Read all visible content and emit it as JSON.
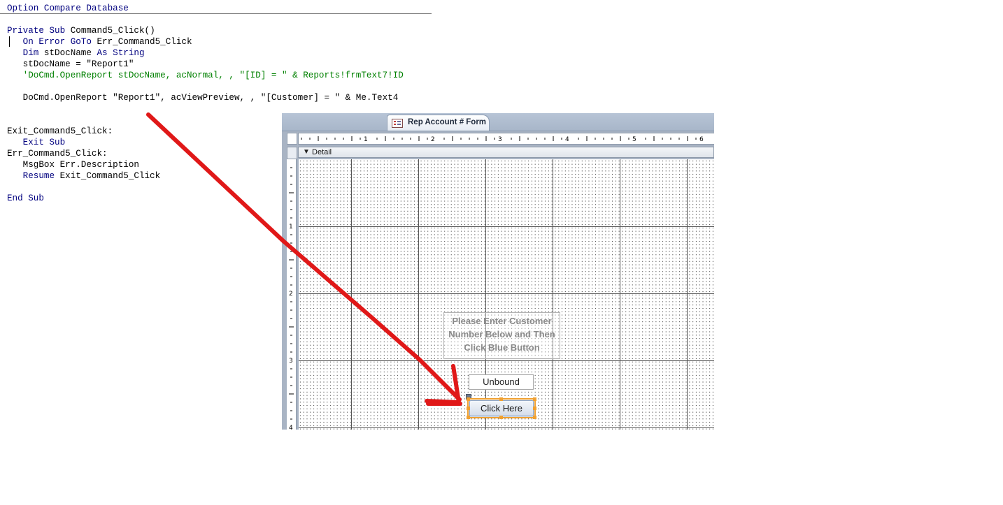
{
  "code_editor": {
    "lines": [
      [
        {
          "t": "Option Compare Database",
          "c": "kw"
        }
      ],
      [],
      [
        {
          "t": "Private Sub ",
          "c": "kw"
        },
        {
          "t": "Command5_Click()",
          "c": "tx"
        }
      ],
      [
        {
          "t": "   On Error GoTo ",
          "c": "kw"
        },
        {
          "t": "Err_Command5_Click",
          "c": "tx"
        }
      ],
      [
        {
          "t": "   Dim ",
          "c": "kw"
        },
        {
          "t": "stDocName ",
          "c": "tx"
        },
        {
          "t": "As String",
          "c": "kw"
        }
      ],
      [
        {
          "t": "   stDocName = \"Report1\"",
          "c": "tx"
        }
      ],
      [
        {
          "t": "   'DoCmd.OpenReport stDocName, acNormal, , \"[ID] = \" & Reports!frmText7!ID",
          "c": "cm"
        }
      ],
      [],
      [
        {
          "t": "   DoCmd.OpenReport \"Report1\", acViewPreview, , \"[Customer] = \" & Me.Text4",
          "c": "tx"
        }
      ],
      [],
      [],
      [
        {
          "t": "Exit_Command5_Click:",
          "c": "tx"
        }
      ],
      [
        {
          "t": "   Exit Sub",
          "c": "kw"
        }
      ],
      [
        {
          "t": "Err_Command5_Click:",
          "c": "tx"
        }
      ],
      [
        {
          "t": "   MsgBox Err.Description",
          "c": "tx"
        }
      ],
      [
        {
          "t": "   Resume ",
          "c": "kw"
        },
        {
          "t": "Exit_Command5_Click",
          "c": "tx"
        }
      ],
      [],
      [
        {
          "t": "End Sub",
          "c": "kw"
        }
      ]
    ]
  },
  "form_designer": {
    "tab_title": "Rep Account # Form",
    "tab_icon": "form-icon",
    "horizontal_ruler_numbers": [
      "1",
      "2",
      "3",
      "4",
      "5",
      "6"
    ],
    "vertical_ruler_numbers": [
      "1",
      "2",
      "3",
      "4"
    ],
    "section": {
      "label": "Detail",
      "icon": "collapse-arrow-icon"
    },
    "controls": {
      "instruction_label": "Please Enter Customer Number Below and Then Click Blue Button",
      "text_box_value": "Unbound",
      "command_button_label": "Click Here"
    },
    "selection_color": "#f0a030"
  },
  "annotation": {
    "arrow_color": "#e01818"
  }
}
